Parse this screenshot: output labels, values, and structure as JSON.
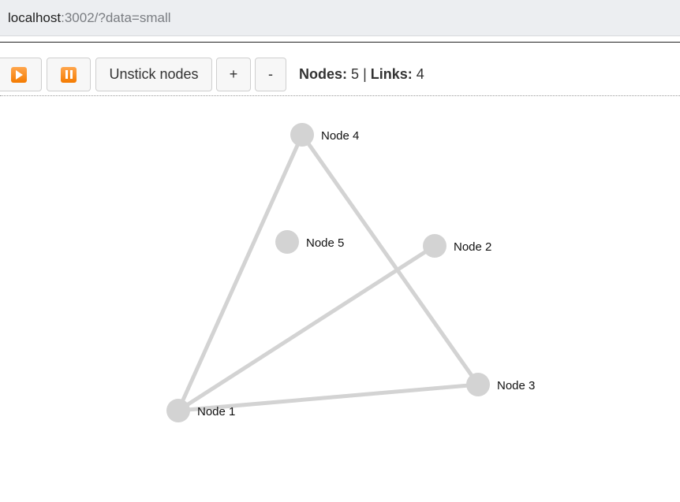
{
  "browser": {
    "url_host": "localhost",
    "url_rest": ":3002/?data=small"
  },
  "toolbar": {
    "play_icon": "play-icon",
    "pause_icon": "pause-icon",
    "unstick_label": "Unstick nodes",
    "plus_label": "+",
    "minus_label": "-",
    "nodes_label": "Nodes:",
    "nodes_count": "5",
    "separator": "|",
    "links_label": "Links:",
    "links_count": "4"
  },
  "graph": {
    "node_color": "#d3d3d3",
    "link_color": "#d3d3d3",
    "nodes": [
      {
        "id": "1",
        "label": "Node 1"
      },
      {
        "id": "2",
        "label": "Node 2"
      },
      {
        "id": "3",
        "label": "Node 3"
      },
      {
        "id": "4",
        "label": "Node 4"
      },
      {
        "id": "5",
        "label": "Node 5"
      }
    ],
    "links": [
      {
        "source": "1",
        "target": "4"
      },
      {
        "source": "1",
        "target": "2"
      },
      {
        "source": "1",
        "target": "3"
      },
      {
        "source": "4",
        "target": "3"
      }
    ]
  }
}
